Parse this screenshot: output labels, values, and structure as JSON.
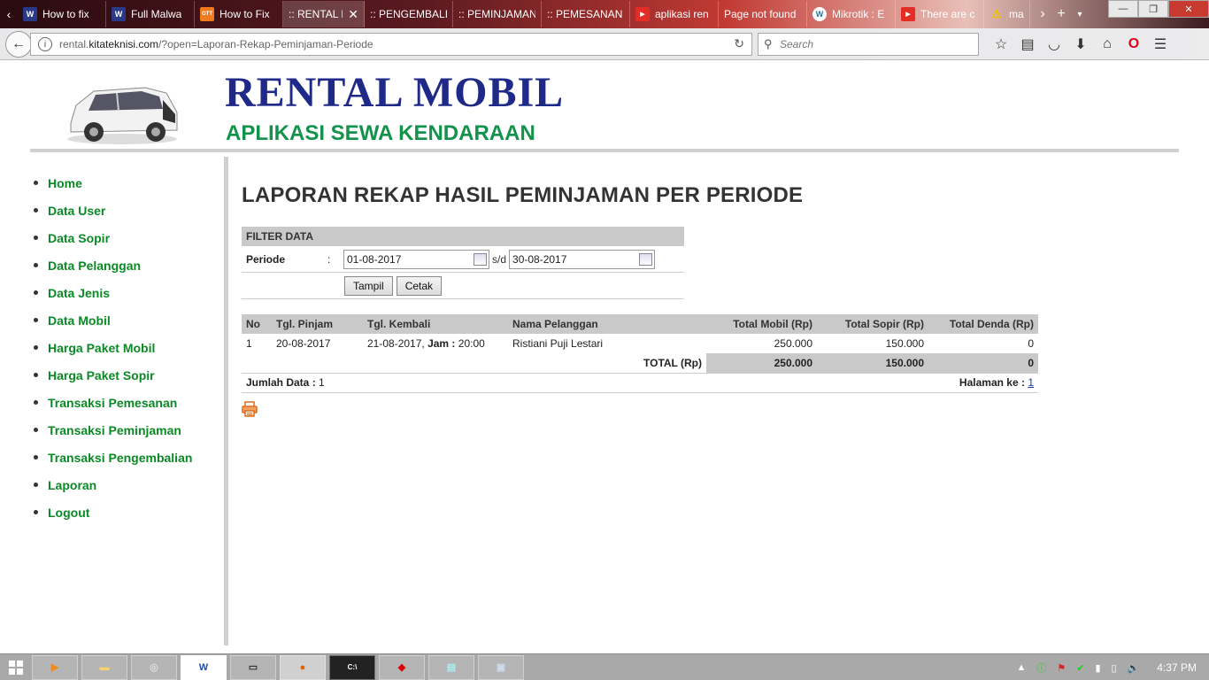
{
  "browser": {
    "tabs": [
      {
        "label": "How to fix",
        "icon": "W"
      },
      {
        "label": "Full Malwa",
        "icon": "W"
      },
      {
        "label": "How to Fix",
        "icon": "OTT"
      },
      {
        "label": ":: RENTAL M",
        "icon": ""
      },
      {
        "label": ":: PENGEMBALI",
        "icon": ""
      },
      {
        "label": ":: PEMINJAMAN",
        "icon": ""
      },
      {
        "label": ":: PEMESANAN",
        "icon": ""
      },
      {
        "label": "aplikasi ren",
        "icon": "YT"
      },
      {
        "label": "Page not found",
        "icon": ""
      },
      {
        "label": "Mikrotik : E",
        "icon": "WP"
      },
      {
        "label": "There are c",
        "icon": "YT"
      },
      {
        "label": "mac",
        "icon": "!"
      }
    ],
    "url": {
      "prefix": "rental.",
      "domain": "kitateknisi.com",
      "path": "/?open=Laporan-Rekap-Peminjaman-Periode"
    },
    "search_placeholder": "Search"
  },
  "header": {
    "title": "RENTAL MOBIL",
    "subtitle": "APLIKASI SEWA KENDARAAN"
  },
  "sidebar": {
    "items": [
      "Home",
      "Data User",
      "Data Sopir",
      "Data Pelanggan",
      "Data Jenis",
      "Data Mobil",
      "Harga Paket Mobil",
      "Harga Paket Sopir",
      "Transaksi Pemesanan",
      "Transaksi Peminjaman",
      "Transaksi Pengembalian",
      "Laporan",
      "Logout"
    ]
  },
  "main": {
    "heading": "LAPORAN REKAP HASIL PEMINJAMAN PER PERIODE",
    "filter": {
      "title": "FILTER DATA",
      "period_label": "Periode",
      "colon": ":",
      "date_from": "01-08-2017",
      "separator": "s/d",
      "date_to": "30-08-2017",
      "btn_show": "Tampil",
      "btn_print": "Cetak"
    },
    "table": {
      "headers": [
        "No",
        "Tgl. Pinjam",
        "Tgl. Kembali",
        "Nama Pelanggan",
        "Total Mobil (Rp)",
        "Total Sopir (Rp)",
        "Total Denda (Rp)"
      ],
      "rows": [
        {
          "no": "1",
          "tgl_pinjam": "20-08-2017",
          "tgl_kembali": "21-08-2017,",
          "jam_label": "Jam :",
          "jam": "20:00",
          "nama": "Ristiani Puji Lestari",
          "total_mobil": "250.000",
          "total_sopir": "150.000",
          "total_denda": "0"
        }
      ],
      "total_label": "TOTAL (Rp)",
      "total_mobil": "250.000",
      "total_sopir": "150.000",
      "total_denda": "0",
      "jumlah_label": "Jumlah Data :",
      "jumlah": "1",
      "halaman_label": "Halaman ke :",
      "halaman": "1"
    }
  },
  "taskbar": {
    "clock": "4:37 PM"
  }
}
